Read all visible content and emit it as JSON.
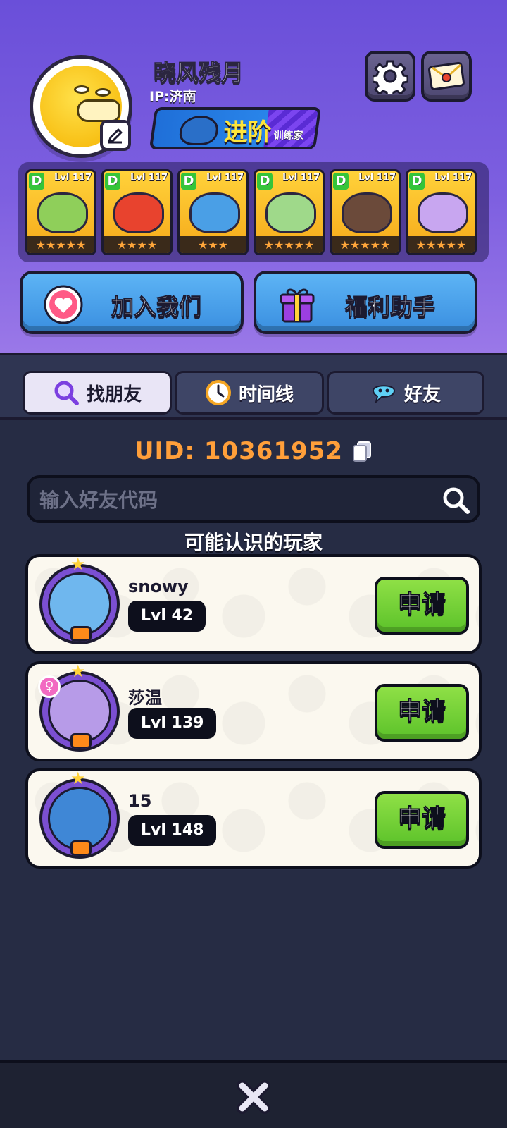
{
  "profile": {
    "name": "晓风残月",
    "ip": "IP:济南",
    "rank_main": "进阶",
    "rank_sub": "训练家"
  },
  "team": [
    {
      "grade": "D",
      "level": "Lvl 117",
      "stars": 5,
      "color": "#8fcf5a"
    },
    {
      "grade": "D",
      "level": "Lvl 117",
      "stars": 4,
      "color": "#e8432e"
    },
    {
      "grade": "D",
      "level": "Lvl 117",
      "stars": 3,
      "color": "#4a9fe6"
    },
    {
      "grade": "D",
      "level": "Lvl 117",
      "stars": 5,
      "color": "#9fd98a"
    },
    {
      "grade": "D",
      "level": "Lvl 117",
      "stars": 5,
      "color": "#6b4a3a"
    },
    {
      "grade": "D",
      "level": "Lvl 117",
      "stars": 5,
      "color": "#c8a6f0"
    }
  ],
  "buttons": {
    "join": "加入我们",
    "welfare": "福利助手"
  },
  "tabs": [
    {
      "label": "找朋友",
      "active": true,
      "icon": "magnifier-icon"
    },
    {
      "label": "时间线",
      "active": false,
      "icon": "clock-icon"
    },
    {
      "label": "好友",
      "active": false,
      "icon": "chat-icon"
    }
  ],
  "uid": {
    "text": "UID: 10361952"
  },
  "search": {
    "placeholder": "输入好友代码",
    "value": ""
  },
  "section_title": "可能认识的玩家",
  "players": [
    {
      "name": "snowy",
      "level": "Lvl 42",
      "button": "申请",
      "avatar_color": "#6fb7ee",
      "gender": ""
    },
    {
      "name": "莎温",
      "level": "Lvl 139",
      "button": "申请",
      "avatar_color": "#b79be8",
      "gender": "♀"
    },
    {
      "name": "15",
      "level": "Lvl 148",
      "button": "申请",
      "avatar_color": "#3f87d6",
      "gender": ""
    }
  ],
  "colors": {
    "accent_uid": "#ff9f3a",
    "apply_green": "#5cc22a",
    "header_purple": "#6a4fd9",
    "button_blue": "#3a8fe0"
  }
}
